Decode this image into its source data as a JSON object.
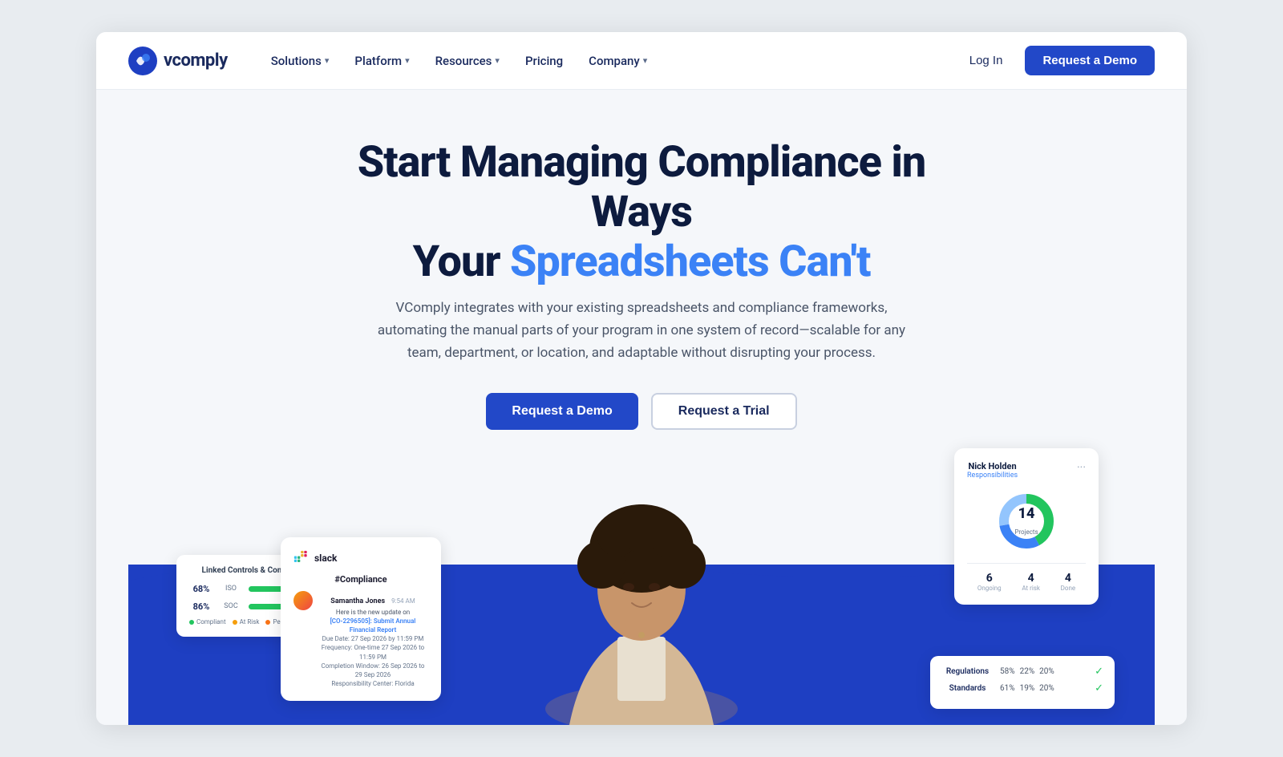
{
  "brand": {
    "logo_text": "vcomply",
    "logo_accent": "#3b82f6"
  },
  "nav": {
    "solutions_label": "Solutions",
    "platform_label": "Platform",
    "resources_label": "Resources",
    "pricing_label": "Pricing",
    "company_label": "Company",
    "login_label": "Log In",
    "demo_button_label": "Request a Demo"
  },
  "hero": {
    "heading_line1": "Start Managing Compliance in Ways",
    "heading_line2_plain": "Your ",
    "heading_line2_accent": "Spreadsheets Can't",
    "subtext": "VComply integrates with your existing spreadsheets and compliance frameworks, automating the manual parts of your program in one system of record—scalable for any team, department, or location, and adaptable without disrupting your process.",
    "cta_primary": "Request a Demo",
    "cta_secondary": "Request a Trial"
  },
  "card_linked": {
    "title": "Linked Controls & Compliance Status",
    "rows": [
      {
        "pct": "68%",
        "label": "ISO",
        "green": 65,
        "yellow": 15,
        "orange": 10,
        "gray": 10
      },
      {
        "pct": "86%",
        "label": "SOC",
        "green": 75,
        "yellow": 10,
        "orange": 8,
        "gray": 7
      }
    ],
    "legend": [
      "Compliant",
      "At Risk",
      "Pending"
    ]
  },
  "card_slack": {
    "app_name": "slack",
    "channel": "#Compliance",
    "sender": "Samantha Jones",
    "time": "9:54 AM",
    "intro": "Here is the new update on",
    "task_id": "[CO-2296505]: Submit Annual Financial Report",
    "details": "Due Date: 27 Sep 2026 by 11:59 PM\nFrequency: One-time 27 Sep 2026 to 11:59 PM\nCompletion Window: 26 Sep 2026 to 29 Sep 2026\nResponsibility Center: Florida"
  },
  "card_nick": {
    "name": "Nick Holden",
    "subtitle": "Responsibilities",
    "projects_total": "14",
    "projects_label": "Projects",
    "stats": [
      {
        "num": "6",
        "label": "Ongoing"
      },
      {
        "num": "4",
        "label": "At risk"
      },
      {
        "num": "4",
        "label": "Done"
      }
    ],
    "donut": {
      "green_pct": 42,
      "blue_pct": 30,
      "light_blue_pct": 28
    }
  },
  "card_regs": {
    "rows": [
      {
        "name": "Regulations",
        "p1": "58%",
        "p2": "22%",
        "p3": "20%",
        "check": true
      },
      {
        "name": "Standards",
        "p1": "61%",
        "p2": "19%",
        "p3": "20%",
        "check": true
      }
    ]
  }
}
